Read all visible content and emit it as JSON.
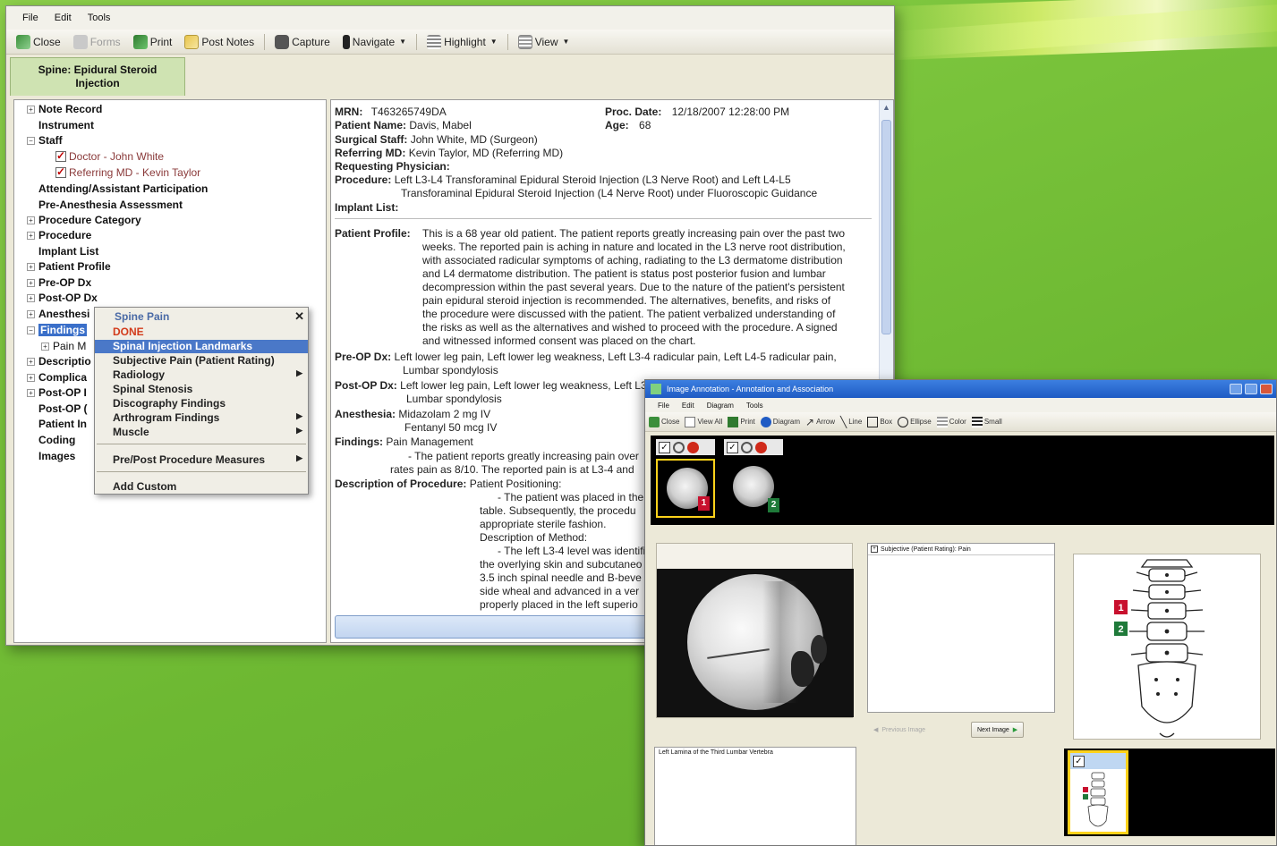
{
  "main_window": {
    "menu": [
      "File",
      "Edit",
      "Tools"
    ],
    "toolbar": {
      "close": "Close",
      "forms": "Forms",
      "print": "Print",
      "post_notes": "Post Notes",
      "capture": "Capture",
      "navigate": "Navigate",
      "highlight": "Highlight",
      "view": "View"
    },
    "tab": {
      "line1": "Spine: Epidural Steroid",
      "line2": "Injection"
    },
    "tree": [
      {
        "label": "Note Record",
        "exp": "+",
        "bold": true,
        "indent": 0
      },
      {
        "label": "Instrument",
        "exp": "",
        "bold": true,
        "indent": 0
      },
      {
        "label": "Staff",
        "exp": "-",
        "bold": true,
        "indent": 0
      },
      {
        "label": "Doctor - John White",
        "check": true,
        "indent": 2
      },
      {
        "label": "Referring MD - Kevin Taylor",
        "check": true,
        "indent": 2
      },
      {
        "label": "Attending/Assistant Participation",
        "exp": "",
        "bold": true,
        "indent": 0
      },
      {
        "label": "Pre-Anesthesia Assessment",
        "exp": "",
        "bold": true,
        "indent": 0
      },
      {
        "label": "Procedure Category",
        "exp": "+",
        "bold": true,
        "indent": 0
      },
      {
        "label": "Procedure",
        "exp": "+",
        "bold": true,
        "indent": 0
      },
      {
        "label": "Implant List",
        "exp": "",
        "bold": true,
        "indent": 0
      },
      {
        "label": "Patient Profile",
        "exp": "+",
        "bold": true,
        "indent": 0
      },
      {
        "label": "Pre-OP Dx",
        "exp": "+",
        "bold": true,
        "indent": 0
      },
      {
        "label": "Post-OP Dx",
        "exp": "+",
        "bold": true,
        "indent": 0
      },
      {
        "label": "Anesthesi",
        "exp": "+",
        "bold": true,
        "indent": 0
      },
      {
        "label": "Findings",
        "exp": "-",
        "bold": true,
        "indent": 0,
        "selected": true
      },
      {
        "label": "Pain M",
        "exp": "+",
        "bold": false,
        "indent": 1
      },
      {
        "label": "Descriptio",
        "exp": "+",
        "bold": true,
        "indent": 0
      },
      {
        "label": "Complica",
        "exp": "+",
        "bold": true,
        "indent": 0
      },
      {
        "label": "Post-OP I",
        "exp": "+",
        "bold": true,
        "indent": 0
      },
      {
        "label": "Post-OP (",
        "exp": "",
        "bold": true,
        "indent": 0
      },
      {
        "label": "Patient In",
        "exp": "",
        "bold": true,
        "indent": 0
      },
      {
        "label": "Coding",
        "exp": "",
        "bold": true,
        "indent": 0
      },
      {
        "label": "Images",
        "exp": "",
        "bold": true,
        "indent": 0
      }
    ],
    "context_menu": {
      "title": "Spine Pain",
      "close": "✕",
      "items": [
        {
          "label": "DONE",
          "type": "done"
        },
        {
          "label": "Spinal Injection Landmarks",
          "type": "highlight"
        },
        {
          "label": "Subjective Pain (Patient Rating)",
          "type": "normal"
        },
        {
          "label": "Radiology",
          "type": "normal",
          "sub": true
        },
        {
          "label": "Spinal Stenosis",
          "type": "normal"
        },
        {
          "label": "Discography Findings",
          "type": "normal"
        },
        {
          "label": "Arthrogram Findings",
          "type": "normal",
          "sub": true
        },
        {
          "label": "Muscle",
          "type": "normal",
          "sub": true
        },
        {
          "label": "Pre/Post Procedure Measures",
          "type": "normal",
          "sub": true
        },
        {
          "label": "Add Custom",
          "type": "normal"
        }
      ]
    },
    "note": {
      "mrn_label": "MRN:",
      "mrn": "T463265749DA",
      "proc_date_label": "Proc. Date:",
      "proc_date": "12/18/2007 12:28:00 PM",
      "patient_name_label": "Patient Name:",
      "patient_name": "Davis, Mabel",
      "age_label": "Age:",
      "age": "68",
      "surgical_staff_label": "Surgical Staff:",
      "surgical_staff": "John White, MD (Surgeon)",
      "referring_label": "Referring MD:",
      "referring": "Kevin Taylor, MD (Referring MD)",
      "requesting_label": "Requesting Physician:",
      "procedure_label": "Procedure:",
      "procedure_1": "Left L3-L4 Transforaminal Epidural Steroid Injection (L3 Nerve Root) and Left L4-L5",
      "procedure_2": "Transforaminal Epidural Steroid Injection (L4 Nerve Root) under Fluoroscopic Guidance",
      "implant_label": "Implant List:",
      "profile_label": "Patient Profile:",
      "profile_lines": [
        "This is a 68 year old patient.  The patient reports greatly increasing pain over the past two",
        "weeks.  The reported pain is aching in nature and located in the L3 nerve root distribution,",
        "with associated radicular symptoms of aching, radiating to the L3 dermatome distribution",
        "and L4 dermatome distribution.  The patient is status post posterior fusion and lumbar",
        "decompression within the past several years.  Due to the nature of the patient's persistent",
        "pain epidural steroid injection is recommended.  The alternatives, benefits, and risks of",
        "the procedure were discussed with the patient.  The patient verbalized understanding of",
        "the risks as well as the alternatives and wished to proceed with the procedure.  A signed",
        "and witnessed informed consent was placed on the chart."
      ],
      "preop_label": "Pre-OP Dx:",
      "preop_1": "Left lower leg pain, Left lower leg weakness, Left L3-4 radicular pain, Left L4-5 radicular pain,",
      "preop_2": "Lumbar spondylosis",
      "postop_label": "Post-OP Dx:",
      "postop_1": "Left lower leg pain, Left lower leg weakness, Left L3-4 radicular pain, Left L4-5 radicular pain,",
      "postop_2": "Lumbar spondylosis",
      "anesthesia_label": "Anesthesia:",
      "anesthesia_1": "Midazolam 2 mg IV",
      "anesthesia_2": "Fentanyl 50 mcg IV",
      "findings_label": "Findings:",
      "findings_1": "Pain Management",
      "findings_2": "- The patient reports greatly increasing pain over",
      "findings_3": "rates pain as 8/10.  The reported pain is at L3-4 and",
      "desc_label": "Description of Procedure:",
      "desc_1": "Patient Positioning:",
      "desc_lines": [
        "- The patient was placed in the",
        "table.  Subsequently, the procedu",
        "appropriate sterile fashion.",
        "Description of Method:",
        "- The left L3-4 level was identifi",
        "the overlying skin and subcutaneo",
        "3.5 inch spinal needle and B-beve",
        "side wheal and advanced in a ver",
        "properly placed in the left superio"
      ]
    }
  },
  "image_window": {
    "title": "Image Annotation - Annotation and Association",
    "menu": [
      "File",
      "Edit",
      "Diagram",
      "Tools"
    ],
    "toolbar": [
      "Close",
      "View All",
      "Print",
      "Diagram",
      "Arrow",
      "Line",
      "Box",
      "Ellipse",
      "Color",
      "Small"
    ],
    "thumb_badges": [
      "1",
      "2"
    ],
    "annotation_item": "Subjective (Patient Rating): Pain",
    "prev_button": "Previous Image",
    "next_button": "Next Image",
    "spine_markers": [
      "1",
      "2"
    ],
    "description": "Left Lamina of the Third Lumbar Vertebra",
    "colors": {
      "marker1": "#c8102e",
      "marker2": "#1f7a3a",
      "select_border": "#ffd21a"
    }
  }
}
